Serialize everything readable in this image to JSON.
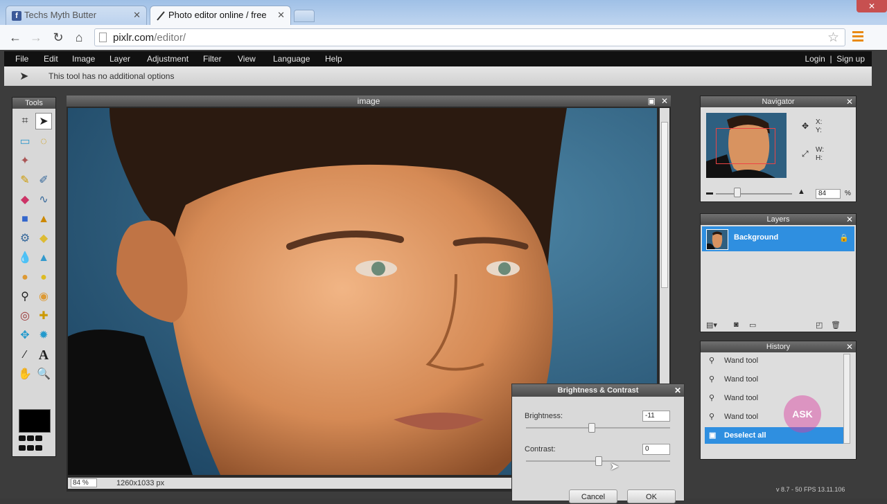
{
  "browser": {
    "tabs": [
      {
        "label": "Techs Myth Butter",
        "icon": "facebook-icon"
      },
      {
        "label": "Photo editor online / free",
        "icon": "pixlr-icon"
      }
    ],
    "url_host": "pixlr.com",
    "url_path": "/editor/",
    "window_close": "✕"
  },
  "menu": {
    "items": [
      "File",
      "Edit",
      "Image",
      "Layer",
      "Adjustment",
      "Filter",
      "View",
      "Language",
      "Help"
    ],
    "login": "Login",
    "separator": "|",
    "signup": "Sign up"
  },
  "options_bar": {
    "text": "This tool has no additional options"
  },
  "tools_panel": {
    "title": "Tools"
  },
  "image_window": {
    "title": "image",
    "zoom": "84",
    "zoom_unit": "%",
    "dimensions": "1260x1033 px"
  },
  "navigator": {
    "title": "Navigator",
    "x_label": "X:",
    "y_label": "Y:",
    "w_label": "W:",
    "h_label": "H:",
    "zoom": "84",
    "zoom_unit": "%"
  },
  "layers": {
    "title": "Layers",
    "items": [
      {
        "name": "Background"
      }
    ]
  },
  "history": {
    "title": "History",
    "items": [
      "Wand tool",
      "Wand tool",
      "Wand tool",
      "Wand tool",
      "Deselect all"
    ],
    "selected_index": 4,
    "watermark": "ASK"
  },
  "dialog": {
    "title": "Brightness & Contrast",
    "brightness_label": "Brightness:",
    "brightness_value": "-11",
    "contrast_label": "Contrast:",
    "contrast_value": "0",
    "cancel": "Cancel",
    "ok": "OK"
  },
  "version_text": "v 8.7 - 50 FPS 13.11.106",
  "colors": {
    "accent": "#2f8fe0",
    "menubar": "#111111",
    "close_button": "#c75050"
  }
}
